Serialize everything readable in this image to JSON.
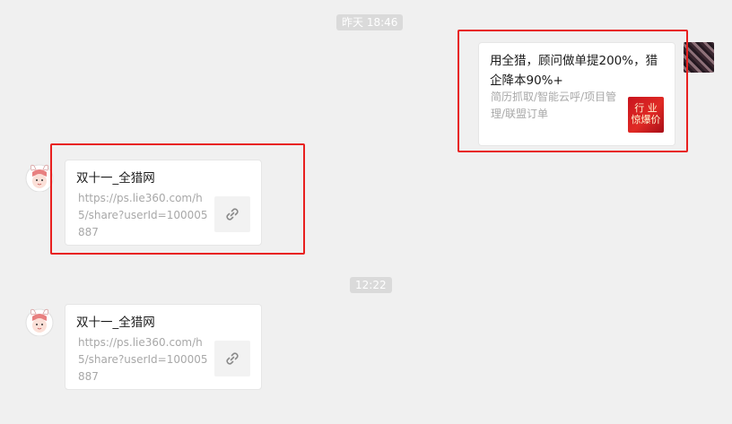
{
  "timestamps": {
    "first": "昨天 18:46",
    "second": "12:22"
  },
  "messages": {
    "outgoing": {
      "title": "用全猎，顾问做单提200%，猎企降本90%+",
      "description": "简历抓取/智能云呼/项目管理/联盟订单",
      "thumb_line1": "行 业",
      "thumb_line2": "惊爆价"
    },
    "incoming_1": {
      "title": "双十一_全猎网",
      "url": "https://ps.lie360.com/h5/share?userId=100005887"
    },
    "incoming_2": {
      "title": "双十一_全猎网",
      "url": "https://ps.lie360.com/h5/share?userId=100005887"
    }
  },
  "icons": {
    "link": "link-icon",
    "self_avatar": "user-avatar-photo",
    "contact_avatar": "cat-girl-avatar"
  },
  "colors": {
    "background": "#f0f0f0",
    "highlight": "#e8201f",
    "timestamp_bg": "#dadada",
    "card_bg": "#ffffff"
  }
}
